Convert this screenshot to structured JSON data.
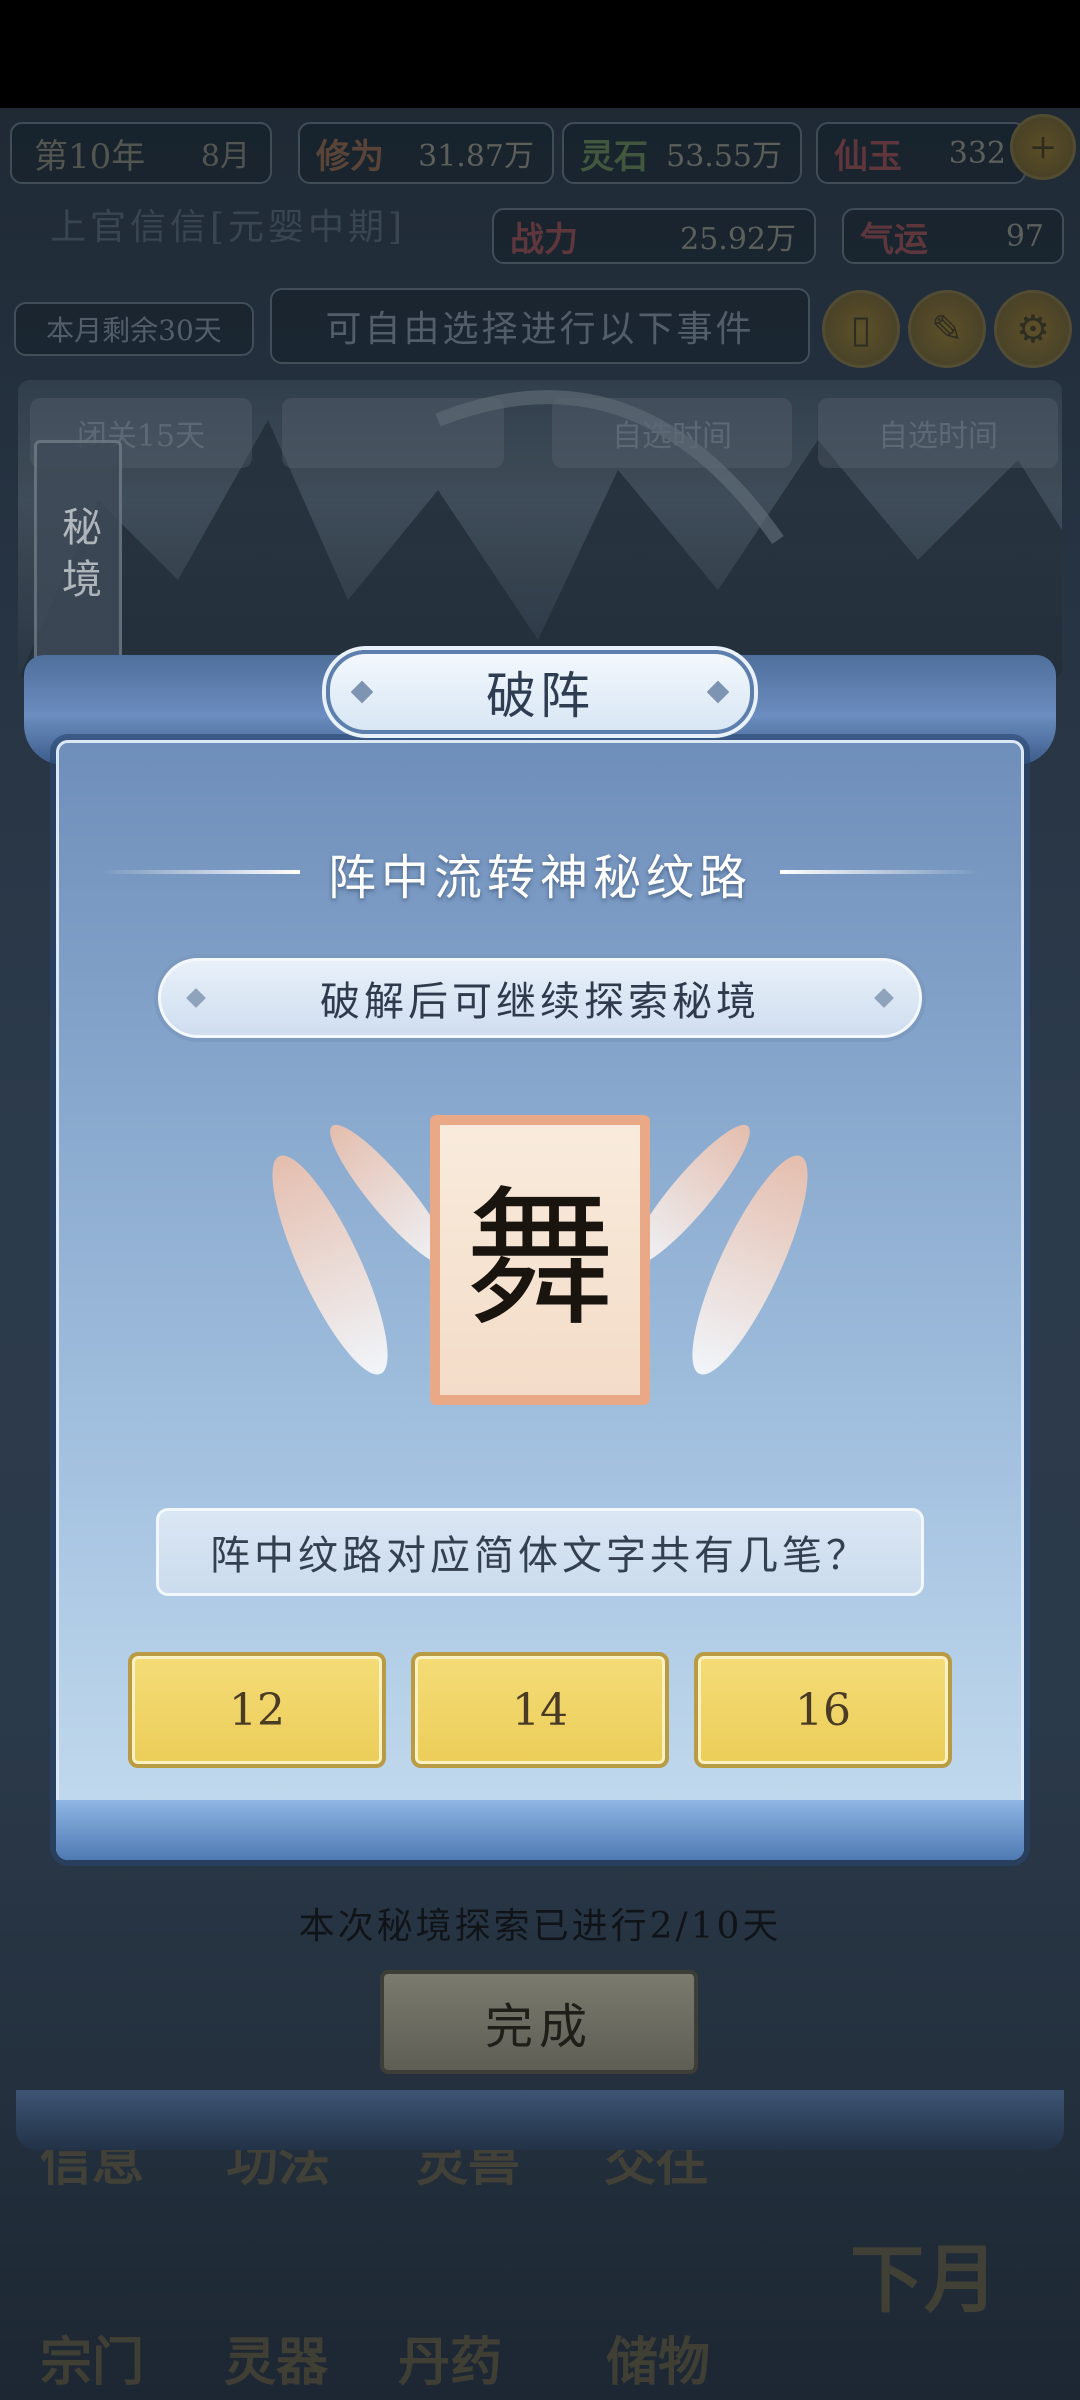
{
  "hud": {
    "year": "第10年",
    "month": "8月",
    "cultivation_label": "修为",
    "cultivation_value": "31.87万",
    "spirit_stone_label": "灵石",
    "spirit_stone_value": "53.55万",
    "jade_label": "仙玉",
    "jade_value": "332",
    "character": "上官信信[元婴中期]",
    "power_label": "战力",
    "power_value": "25.92万",
    "luck_label": "气运",
    "luck_value": "97",
    "days_left": "本月剩余30天",
    "event_hint": "可自由选择进行以下事件"
  },
  "background_tabs": [
    "闭关15天",
    "",
    "自选时间",
    "自选时间"
  ],
  "side_tag": "秘境",
  "bottom_nav": [
    "信息",
    "功法",
    "灵兽",
    "交往",
    "宗门",
    "灵器",
    "丹药",
    "储物",
    "下月"
  ],
  "dialog": {
    "title": "破阵",
    "subtitle": "阵中流转神秘纹路",
    "hint": "破解后可继续探索秘境",
    "seal_glyph": "舞",
    "question": "阵中纹路对应简体文字共有几笔？",
    "answers": [
      "12",
      "14",
      "16"
    ]
  },
  "progress_text": "本次秘境探索已进行2/10天",
  "done_label": "完成",
  "colors": {
    "answer_yellow": "#eccd59",
    "dialog_blue": "#86a6cc",
    "title_text": "#2f3d52"
  }
}
